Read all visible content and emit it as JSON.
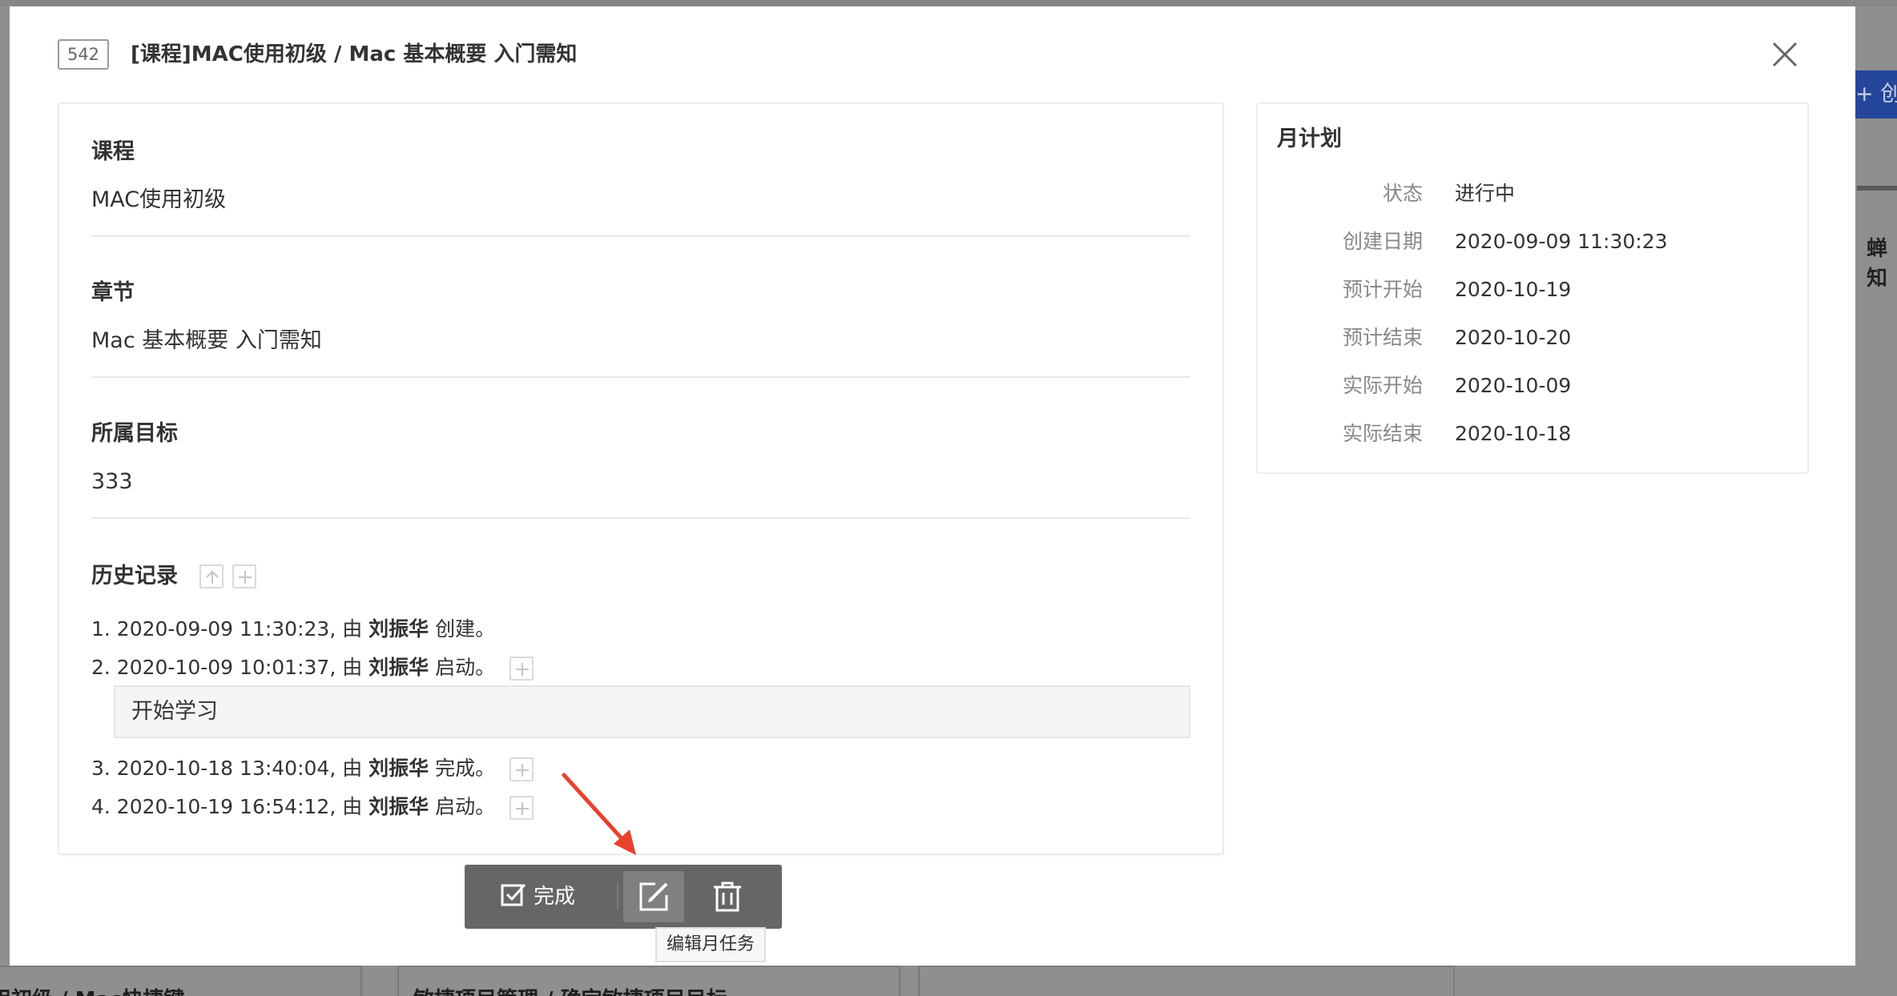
{
  "background": {
    "create_button_label": "+ 创",
    "right_text": "蝉知",
    "bottom_text_left": "用初级 / Mac快捷键",
    "bottom_text_mid": "敏捷项目管理 / 确定敏捷项目目标"
  },
  "modal": {
    "id": "542",
    "title": "[课程]MAC使用初级 / Mac 基本概要 入门需知",
    "close_icon": "close-icon"
  },
  "details": {
    "course_label": "课程",
    "course_value": "MAC使用初级",
    "chapter_label": "章节",
    "chapter_value": "Mac 基本概要 入门需知",
    "goal_label": "所属目标",
    "goal_value": "333",
    "history_label": "历史记录"
  },
  "history": [
    {
      "prefix": "1. 2020-09-09 11:30:23, 由 ",
      "user": "刘振华",
      "action": " 创建。"
    },
    {
      "prefix": "2. 2020-10-09 10:01:37, 由 ",
      "user": "刘振华",
      "action": " 启动。"
    },
    {
      "prefix": "3. 2020-10-18 13:40:04, 由 ",
      "user": "刘振华",
      "action": " 完成。"
    },
    {
      "prefix": "4. 2020-10-19 16:54:12, 由 ",
      "user": "刘振华",
      "action": " 启动。"
    }
  ],
  "history_comment": "开始学习",
  "plan": {
    "title": "月计划",
    "rows": [
      {
        "key": "状态",
        "value": "进行中"
      },
      {
        "key": "创建日期",
        "value": "2020-09-09 11:30:23"
      },
      {
        "key": "预计开始",
        "value": "2020-10-19"
      },
      {
        "key": "预计结束",
        "value": "2020-10-20"
      },
      {
        "key": "实际开始",
        "value": "2020-10-09"
      },
      {
        "key": "实际结束",
        "value": "2020-10-18"
      }
    ]
  },
  "actions": {
    "complete_label": "完成",
    "edit_tooltip": "编辑月任务"
  },
  "colors": {
    "annotation_arrow": "#e8412c",
    "action_bar": "#666666"
  }
}
